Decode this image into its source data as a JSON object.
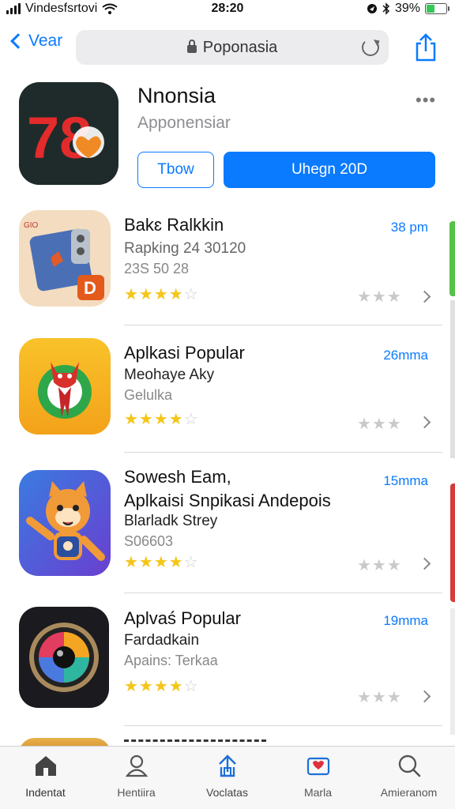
{
  "status_bar": {
    "carrier": "Vindesfsrtovi",
    "time": "28:20",
    "battery": "39%"
  },
  "nav": {
    "back_label": "Vear",
    "url": "Poponasia"
  },
  "hero": {
    "icon_text": "78",
    "title": "Nnonsia",
    "subtitle": "Apponensiar",
    "more": "•••",
    "button_secondary": "Tbow",
    "button_primary": "Uhegn 20D"
  },
  "apps": [
    {
      "title": "Bakɛ Ralkkin",
      "line2": "Rapking 24 30120",
      "line3": "23S 50 28",
      "size": "38 pm",
      "rating": 3.5,
      "stars_on": "★★★★",
      "stars_off": "☆"
    },
    {
      "title": "Aplkasi Popular",
      "line2": "Meohaye Aky",
      "line3": "Gelulka",
      "size": "26mma",
      "rating": 3.5,
      "stars_on": "★★★★",
      "stars_off": "☆"
    },
    {
      "title": "Sowesh Eam,",
      "title2": "Aplkaisi Snpikasi Andepois",
      "line2": "Blarladk Strey",
      "line3": "S06603",
      "size": "15mma",
      "rating": 3.5,
      "stars_on": "★★★★",
      "stars_off": "☆"
    },
    {
      "title": "Aplvaś Popular",
      "line2": "Fardadkain",
      "line3": "Apains: Terkaa",
      "size": "19mma",
      "rating": 3.5,
      "stars_on": "★★★★",
      "stars_off": "☆"
    }
  ],
  "gray_stars": "★★★",
  "tabs": [
    {
      "label": "Indentat",
      "icon": "home-icon"
    },
    {
      "label": "Hentiira",
      "icon": "person-icon"
    },
    {
      "label": "Voclatas",
      "icon": "upload-icon"
    },
    {
      "label": "Marla",
      "icon": "heart-calendar-icon"
    },
    {
      "label": "Amieranom",
      "icon": "search-icon"
    }
  ],
  "colors": {
    "accent": "#0a7aff",
    "star": "#f5c518",
    "tabbar": "#f7f7f7"
  }
}
